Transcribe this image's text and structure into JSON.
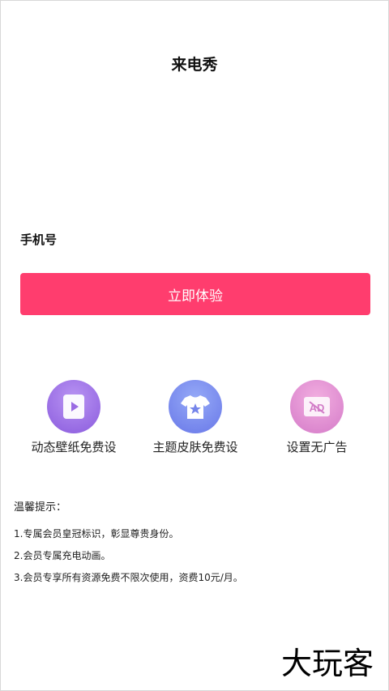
{
  "header": {
    "title": "来电秀"
  },
  "form": {
    "phone_label": "手机号"
  },
  "cta": {
    "label": "立即体验"
  },
  "features": [
    {
      "icon": "play-video-icon",
      "label": "动态壁纸免费设",
      "color_from": "#b48cf0",
      "color_to": "#8d5fdf"
    },
    {
      "icon": "tshirt-star-icon",
      "label": "主题皮肤免费设",
      "color_from": "#8ea4f6",
      "color_to": "#6a7ae9"
    },
    {
      "icon": "no-ad-icon",
      "label": "设置无广告",
      "color_from": "#f0a6dc",
      "color_to": "#d77bcb",
      "icon_text": "AD"
    }
  ],
  "notice": {
    "title": "温馨提示：",
    "items": [
      "1.专属会员皇冠标识，彰显尊贵身份。",
      "2.会员专属充电动画。",
      "3.会员专享所有资源免费不限次使用，资费10元/月。"
    ]
  },
  "watermark": {
    "text": "大玩客"
  },
  "colors": {
    "accent": "#ff3d6e"
  }
}
